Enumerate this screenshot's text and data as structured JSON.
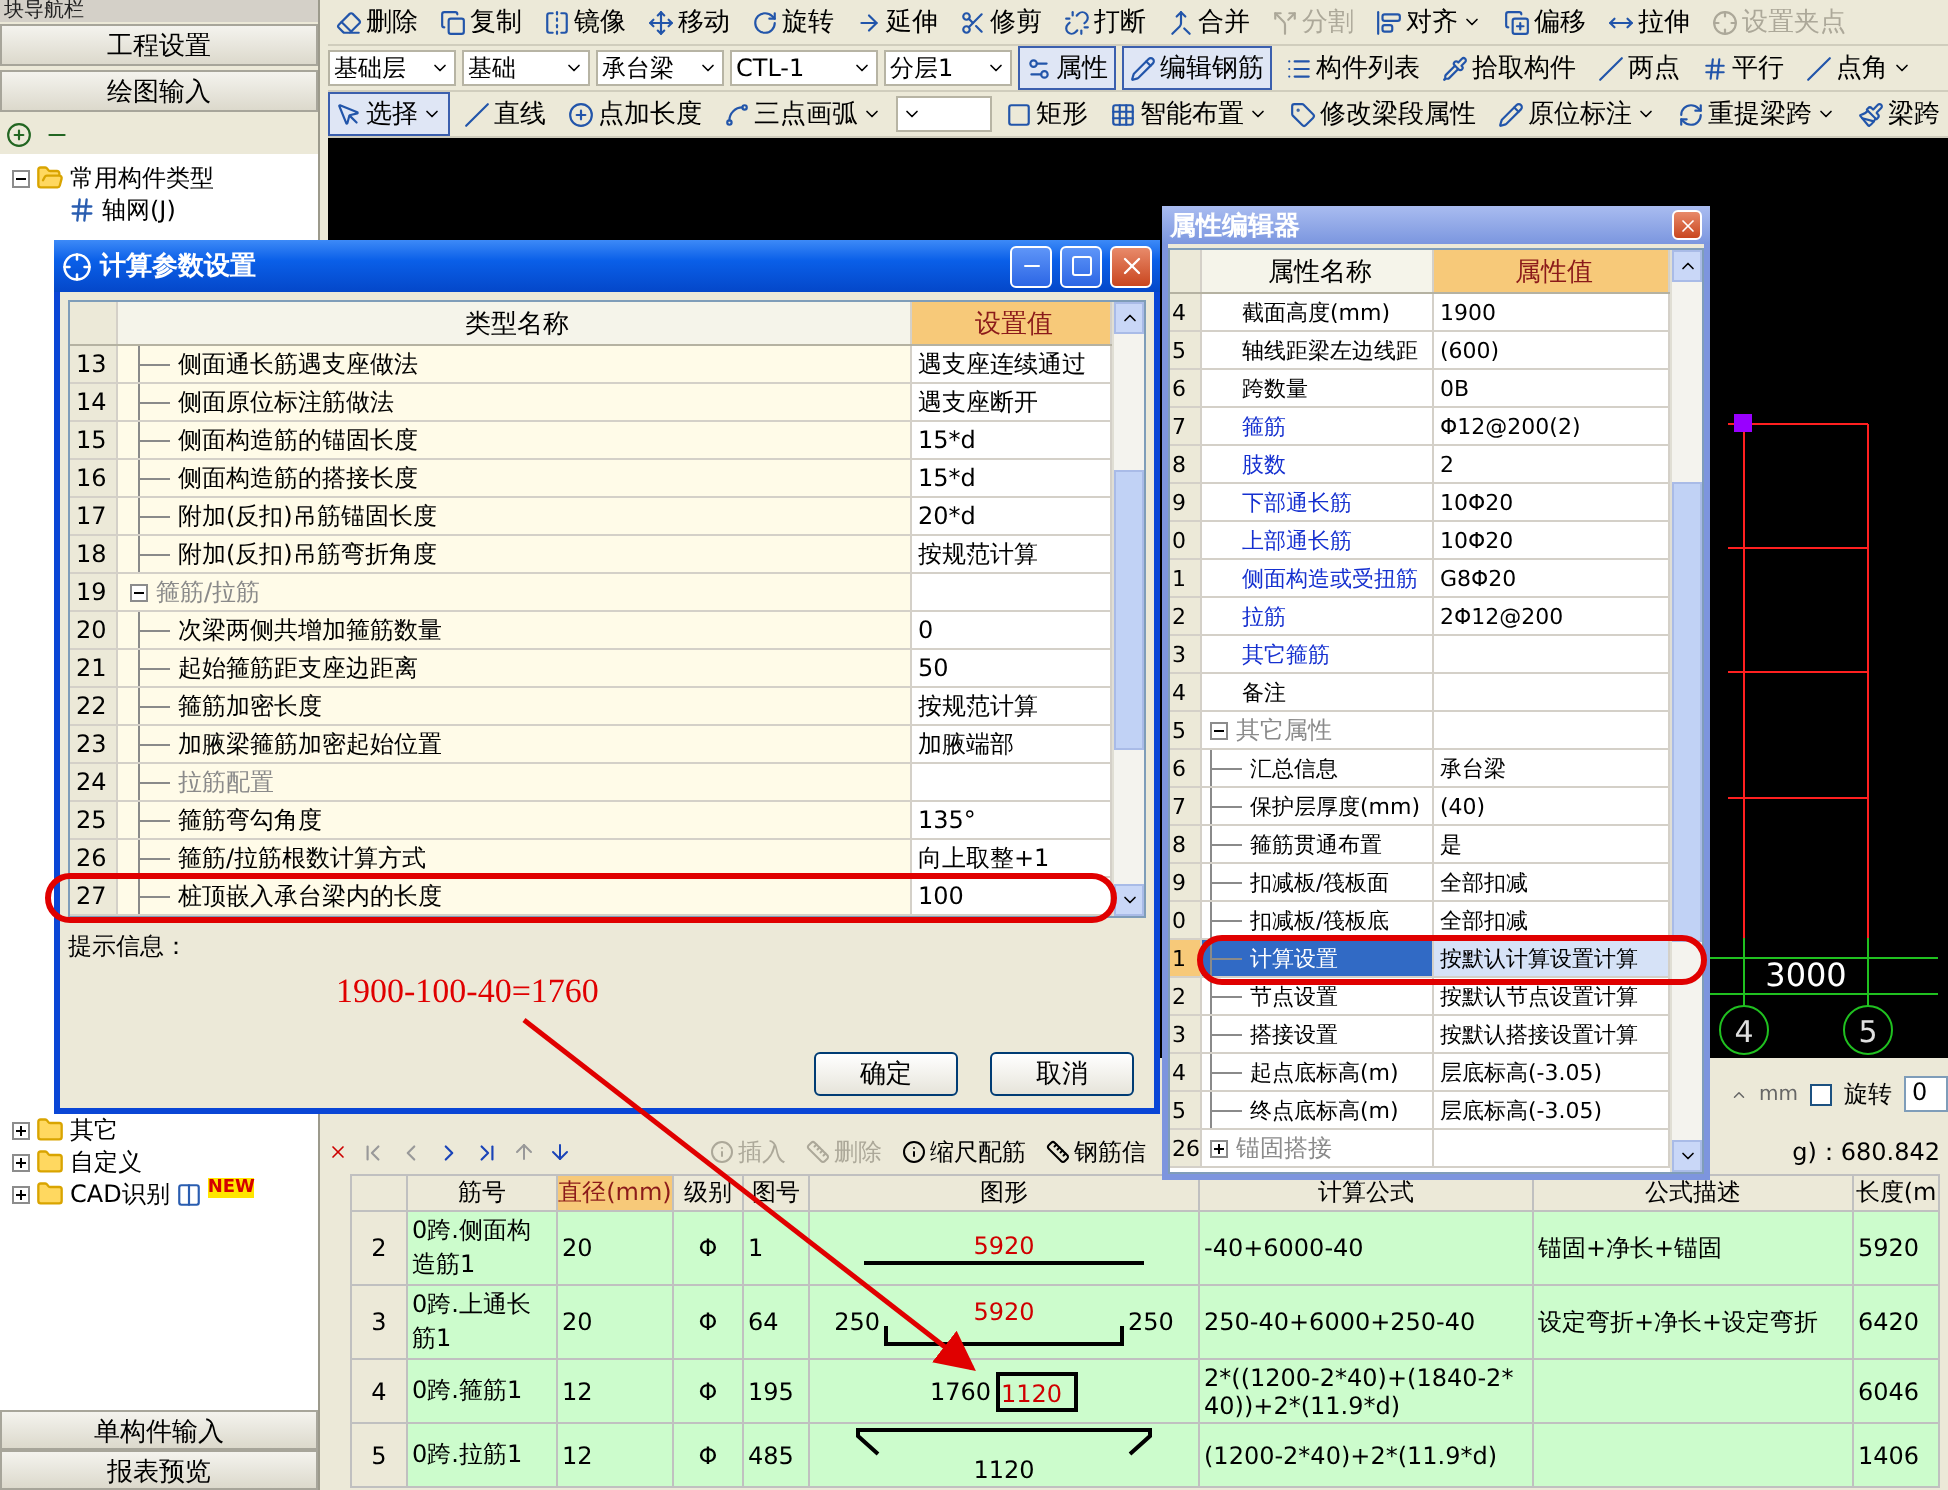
{
  "sidebar": {
    "title": "块导航栏",
    "tabs": [
      "工程设置",
      "绘图输入"
    ],
    "tree": [
      {
        "label": "常用构件类型",
        "expanded": true,
        "children": [
          {
            "label": "轴网(J)"
          }
        ]
      }
    ],
    "tree_lower": [
      {
        "label": "其它",
        "expanded": false
      },
      {
        "label": "自定义",
        "expanded": false
      },
      {
        "label": "CAD识别",
        "expanded": false,
        "badge": "NEW"
      }
    ],
    "footer": [
      "单构件输入",
      "报表预览"
    ]
  },
  "toolbars": [
    {
      "items": [
        {
          "kind": "button",
          "label": "删除",
          "pressed": false,
          "disabled": false,
          "menu": false
        },
        {
          "kind": "button",
          "label": "复制",
          "pressed": false,
          "disabled": false,
          "menu": false
        },
        {
          "kind": "button",
          "label": "镜像",
          "pressed": false,
          "disabled": false,
          "menu": false
        },
        {
          "kind": "button",
          "label": "移动",
          "pressed": false,
          "disabled": false,
          "menu": false
        },
        {
          "kind": "button",
          "label": "旋转",
          "pressed": false,
          "disabled": false,
          "menu": false
        },
        {
          "kind": "button",
          "label": "延伸",
          "pressed": false,
          "disabled": false,
          "menu": false
        },
        {
          "kind": "button",
          "label": "修剪",
          "pressed": false,
          "disabled": false,
          "menu": false
        },
        {
          "kind": "button",
          "label": "打断",
          "pressed": false,
          "disabled": false,
          "menu": false
        },
        {
          "kind": "button",
          "label": "合并",
          "pressed": false,
          "disabled": false,
          "menu": false
        },
        {
          "kind": "button",
          "label": "分割",
          "pressed": false,
          "disabled": true,
          "menu": false
        },
        {
          "kind": "button",
          "label": "对齐",
          "pressed": false,
          "disabled": false,
          "menu": true
        },
        {
          "kind": "button",
          "label": "偏移",
          "pressed": false,
          "disabled": false,
          "menu": false
        },
        {
          "kind": "button",
          "label": "拉伸",
          "pressed": false,
          "disabled": false,
          "menu": false
        },
        {
          "kind": "button",
          "label": "设置夹点",
          "pressed": false,
          "disabled": true,
          "menu": false
        }
      ]
    },
    {
      "items": [
        {
          "kind": "select",
          "value": "基础层"
        },
        {
          "kind": "select",
          "value": "基础"
        },
        {
          "kind": "select",
          "value": "承台梁"
        },
        {
          "kind": "select",
          "value": "CTL-1"
        },
        {
          "kind": "select",
          "value": "分层1"
        },
        {
          "kind": "button",
          "label": "属性",
          "pressed": true,
          "disabled": false,
          "menu": false
        },
        {
          "kind": "button",
          "label": "编辑钢筋",
          "pressed": true,
          "disabled": false,
          "menu": false
        },
        {
          "kind": "button",
          "label": "构件列表",
          "pressed": false,
          "disabled": false,
          "menu": false
        },
        {
          "kind": "button",
          "label": "拾取构件",
          "pressed": false,
          "disabled": false,
          "menu": false
        },
        {
          "kind": "button",
          "label": "两点",
          "pressed": false,
          "disabled": false,
          "menu": false
        },
        {
          "kind": "button",
          "label": "平行",
          "pressed": false,
          "disabled": false,
          "menu": false
        },
        {
          "kind": "button",
          "label": "点角",
          "pressed": false,
          "disabled": false,
          "menu": true
        }
      ]
    },
    {
      "items": [
        {
          "kind": "button",
          "label": "选择",
          "pressed": true,
          "disabled": false,
          "menu": true
        },
        {
          "kind": "button",
          "label": "直线",
          "pressed": false,
          "disabled": false,
          "menu": false
        },
        {
          "kind": "button",
          "label": "点加长度",
          "pressed": false,
          "disabled": false,
          "menu": false
        },
        {
          "kind": "button",
          "label": "三点画弧",
          "pressed": false,
          "disabled": false,
          "menu": true
        },
        {
          "kind": "select"
        },
        {
          "kind": "button",
          "label": "矩形",
          "pressed": false,
          "disabled": false,
          "menu": false
        },
        {
          "kind": "button",
          "label": "智能布置",
          "pressed": false,
          "disabled": false,
          "menu": true
        },
        {
          "kind": "button",
          "label": "修改梁段属性",
          "pressed": false,
          "disabled": false,
          "menu": false
        },
        {
          "kind": "button",
          "label": "原位标注",
          "pressed": false,
          "disabled": false,
          "menu": true
        },
        {
          "kind": "button",
          "label": "重提梁跨",
          "pressed": false,
          "disabled": false,
          "menu": true
        },
        {
          "kind": "button",
          "label": "梁跨",
          "pressed": false,
          "disabled": false,
          "menu": false
        }
      ]
    }
  ],
  "canvas": {
    "dimension": "3000",
    "axes": [
      "4",
      "5"
    ]
  },
  "status": {
    "unit": "mm",
    "rotate_checked": false,
    "rotate_label": "旋转",
    "rotate_value": "0"
  },
  "rebar_toolbar": [
    {
      "label": "插入",
      "disabled": true
    },
    {
      "label": "删除",
      "disabled": true
    },
    {
      "label": "缩尺配筋",
      "disabled": false
    },
    {
      "label": "钢筋信",
      "disabled": false
    }
  ],
  "rebar_total": "g)：680.842",
  "rebar_table": {
    "columns": [
      {
        "selected": false
      },
      {
        "label": "筋号",
        "selected": false
      },
      {
        "label": "直径(mm)",
        "selected": true
      },
      {
        "label": "级别",
        "selected": false
      },
      {
        "label": "图号",
        "selected": false
      },
      {
        "label": "图形",
        "selected": false
      },
      {
        "label": "计算公式",
        "selected": false
      },
      {
        "label": "公式描述",
        "selected": false
      },
      {
        "label": "长度(m",
        "selected": false
      }
    ],
    "rows": [
      {
        "no": "2",
        "name": "0跨.侧面构造筋1",
        "diameter": "20",
        "grade": "Φ",
        "figure": "1",
        "shape": {
          "kind": "straight",
          "labels": [
            "5920"
          ]
        },
        "formula": "-40+6000-40",
        "description": "锚固+净长+锚固",
        "length": "5920"
      },
      {
        "no": "3",
        "name": "0跨.上通长筋1",
        "diameter": "20",
        "grade": "Φ",
        "figure": "64",
        "shape": {
          "kind": "bent",
          "labels": [
            "250",
            "5920",
            "250"
          ]
        },
        "formula": "250-40+6000+250-40",
        "description": "设定弯折+净长+设定弯折",
        "length": "6420"
      },
      {
        "no": "4",
        "name": "0跨.箍筋1",
        "diameter": "12",
        "grade": "Φ",
        "figure": "195",
        "shape": {
          "kind": "stirrup",
          "labels": [
            "1760",
            "1120"
          ]
        },
        "formula": "2*((1200-2*40)+(1840-2*40))+2*(11.9*d)",
        "length": "6046"
      },
      {
        "no": "5",
        "name": "0跨.拉筋1",
        "diameter": "12",
        "grade": "Φ",
        "figure": "485",
        "shape": {
          "kind": "hook",
          "labels": [
            "1120"
          ]
        },
        "formula": "(1200-2*40)+2*(11.9*d)",
        "length": "1406"
      }
    ]
  },
  "param_dialog": {
    "title": "计算参数设置",
    "columns": [
      "类型名称",
      "设置值"
    ],
    "rows": [
      {
        "no": "13",
        "kind": "child",
        "name": "侧面通长筋遇支座做法",
        "value": "遇支座连续通过"
      },
      {
        "no": "14",
        "kind": "child",
        "name": "侧面原位标注筋做法",
        "value": "遇支座断开"
      },
      {
        "no": "15",
        "kind": "child",
        "name": "侧面构造筋的锚固长度",
        "value": "15*d"
      },
      {
        "no": "16",
        "kind": "child",
        "name": "侧面构造筋的搭接长度",
        "value": "15*d"
      },
      {
        "no": "17",
        "kind": "child",
        "name": "附加(反扣)吊筋锚固长度",
        "value": "20*d"
      },
      {
        "no": "18",
        "kind": "child",
        "name": "附加(反扣)吊筋弯折角度",
        "value": "按规范计算"
      },
      {
        "no": "19",
        "kind": "group",
        "name": "箍筋/拉筋",
        "expanded": true
      },
      {
        "no": "20",
        "kind": "child",
        "name": "次梁两侧共增加箍筋数量",
        "value": "0"
      },
      {
        "no": "21",
        "kind": "child",
        "name": "起始箍筋距支座边距离",
        "value": "50"
      },
      {
        "no": "22",
        "kind": "child",
        "name": "箍筋加密长度",
        "value": "按规范计算"
      },
      {
        "no": "23",
        "kind": "child",
        "name": "加腋梁箍筋加密起始位置",
        "value": "加腋端部"
      },
      {
        "no": "24",
        "kind": "category",
        "name": "拉筋配置"
      },
      {
        "no": "25",
        "kind": "child",
        "name": "箍筋弯勾角度",
        "value": "135°"
      },
      {
        "no": "26",
        "kind": "child",
        "name": "箍筋/拉筋根数计算方式",
        "value": "向上取整+1"
      },
      {
        "no": "27",
        "kind": "child",
        "name": "桩顶嵌入承台梁内的长度",
        "value": "100"
      }
    ],
    "hint_label": "提示信息：",
    "note": "1900-100-40=1760",
    "buttons": [
      "确定",
      "取消"
    ]
  },
  "prop_dialog": {
    "title": "属性编辑器",
    "columns": [
      "属性名称",
      "属性值"
    ],
    "rows": [
      {
        "no": "4",
        "kind": "plain",
        "name": "截面高度(mm)",
        "value": "1900",
        "selected": false
      },
      {
        "no": "5",
        "kind": "plain",
        "name": "轴线距梁左边线距",
        "value": "(600)",
        "selected": false
      },
      {
        "no": "6",
        "kind": "plain",
        "name": "跨数量",
        "value": "0B",
        "selected": false
      },
      {
        "no": "7",
        "kind": "link",
        "name": "箍筋",
        "value": "Φ12@200(2)",
        "selected": false
      },
      {
        "no": "8",
        "kind": "link",
        "name": "肢数",
        "value": "2",
        "selected": false
      },
      {
        "no": "9",
        "kind": "link",
        "name": "下部通长筋",
        "value": "10Φ20",
        "selected": false
      },
      {
        "no": "0",
        "kind": "link",
        "name": "上部通长筋",
        "value": "10Φ20",
        "selected": false
      },
      {
        "no": "1",
        "kind": "link",
        "name": "侧面构造或受扭筋",
        "value": "G8Φ20",
        "selected": false
      },
      {
        "no": "2",
        "kind": "link",
        "name": "拉筋",
        "value": "2Φ12@200",
        "selected": false
      },
      {
        "no": "3",
        "kind": "link",
        "name": "其它箍筋",
        "selected": false
      },
      {
        "no": "4",
        "kind": "plain",
        "name": "备注",
        "selected": false
      },
      {
        "no": "5",
        "kind": "group",
        "name": "其它属性",
        "expanded": true,
        "selected": false
      },
      {
        "no": "6",
        "kind": "child",
        "name": "汇总信息",
        "value": "承台梁",
        "selected": false
      },
      {
        "no": "7",
        "kind": "child",
        "name": "保护层厚度(mm)",
        "value": "(40)",
        "selected": false
      },
      {
        "no": "8",
        "kind": "child",
        "name": "箍筋贯通布置",
        "value": "是",
        "selected": false
      },
      {
        "no": "9",
        "kind": "child",
        "name": "扣减板/筏板面",
        "value": "全部扣减",
        "selected": false
      },
      {
        "no": "0",
        "kind": "child",
        "name": "扣减板/筏板底",
        "value": "全部扣减",
        "selected": false
      },
      {
        "no": "1",
        "kind": "child",
        "name": "计算设置",
        "value": "按默认计算设置计算",
        "selected": true
      },
      {
        "no": "2",
        "kind": "child",
        "name": "节点设置",
        "value": "按默认节点设置计算",
        "selected": false
      },
      {
        "no": "3",
        "kind": "child",
        "name": "搭接设置",
        "value": "按默认搭接设置计算",
        "selected": false
      },
      {
        "no": "4",
        "kind": "child",
        "name": "起点底标高(m)",
        "value": "层底标高(-3.05)",
        "selected": false
      },
      {
        "no": "5",
        "kind": "child",
        "name": "终点底标高(m)",
        "value": "层底标高(-3.05)",
        "selected": false
      },
      {
        "no": "26",
        "kind": "group",
        "name": "锚固搭接",
        "expanded": false,
        "selected": false
      }
    ]
  }
}
